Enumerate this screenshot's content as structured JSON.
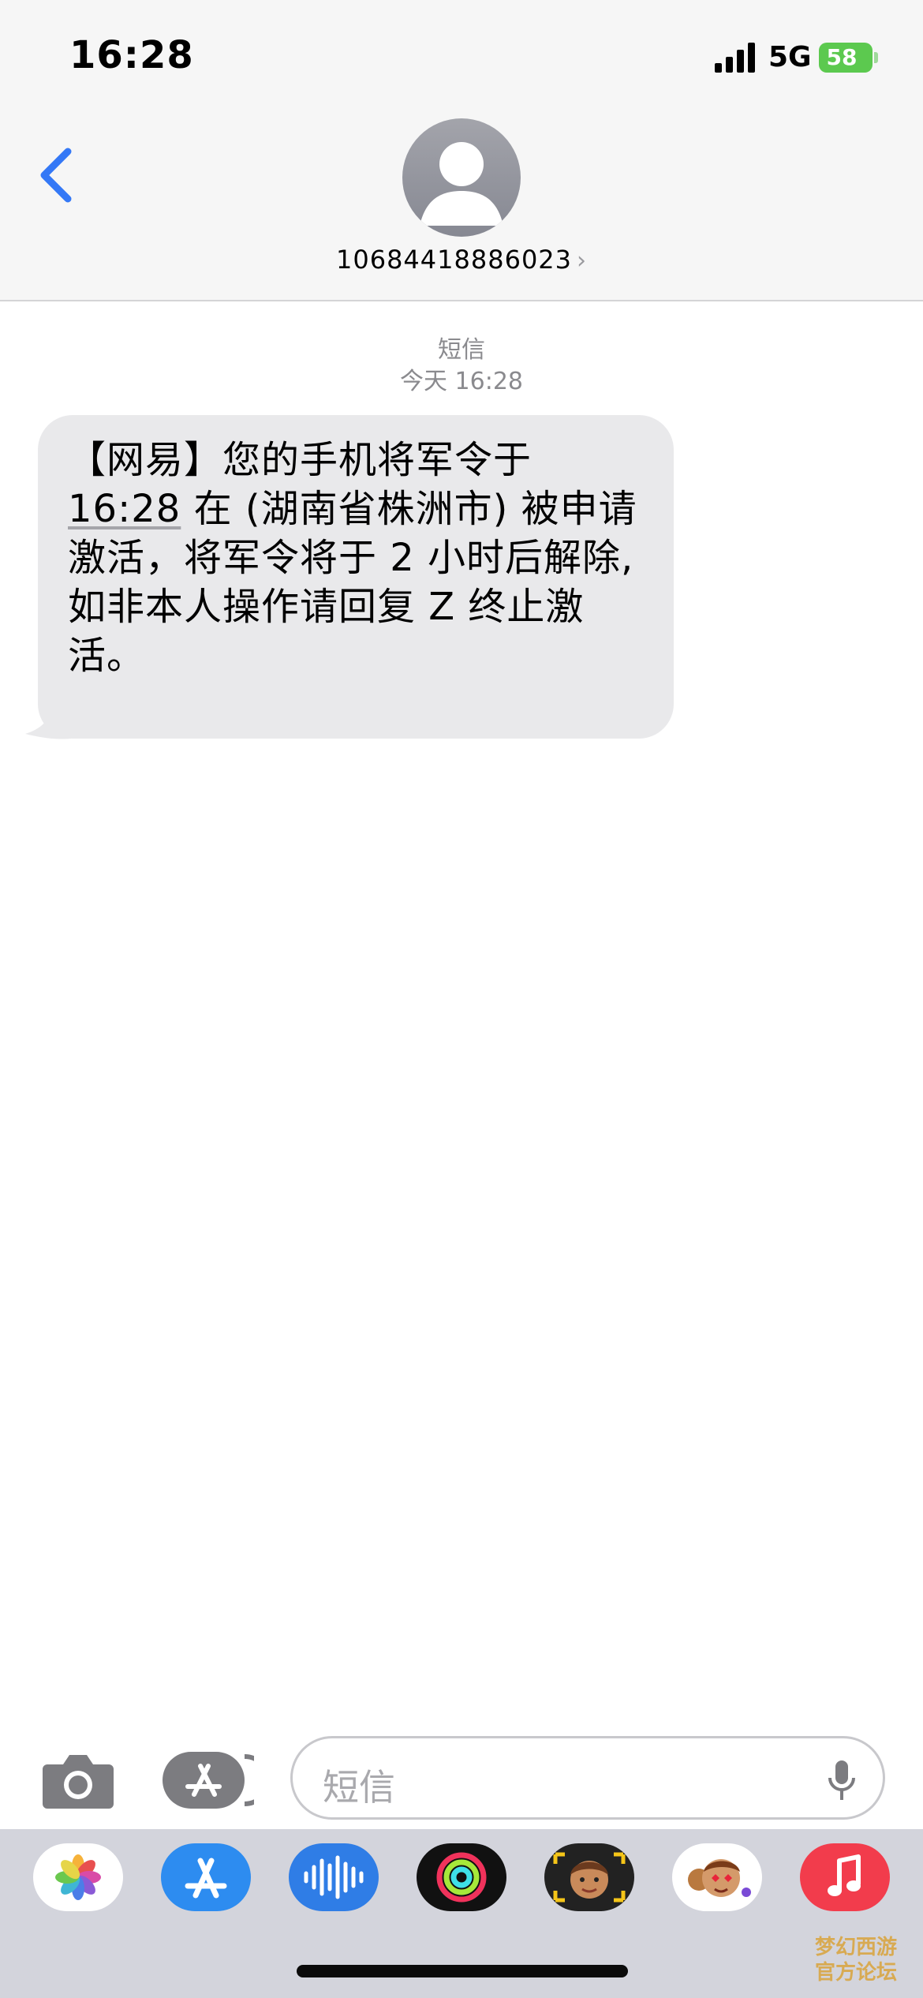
{
  "status_bar": {
    "time": "16:28",
    "network": "5G",
    "battery": "58"
  },
  "header": {
    "contact_number": "10684418886023",
    "chevron": "›"
  },
  "conversation": {
    "service_label": "短信",
    "timestamp": "今天 16:28",
    "message": {
      "line1": "【网易】您的手机将军令于",
      "time_link": "16:28",
      "line2_rest": "在 (湖南省株洲市) 被申请",
      "line3": "激活，将军令将于 2 小时后解除,",
      "line4": "如非本人操作请回复 Z 终止激",
      "line5": "活。"
    }
  },
  "input_bar": {
    "placeholder": "短信"
  },
  "app_drawer": {
    "apps": [
      "photos-icon",
      "app-store-icon",
      "audio-messages-icon",
      "fitness-icon",
      "memoji-icon",
      "memoji-stickers-icon",
      "music-icon"
    ]
  },
  "watermark": {
    "line1": "梦幻西游",
    "line2": "官方论坛"
  },
  "colors": {
    "accent": "#3478f6",
    "bubble": "#e9e9eb",
    "battery": "#5cc94f"
  }
}
